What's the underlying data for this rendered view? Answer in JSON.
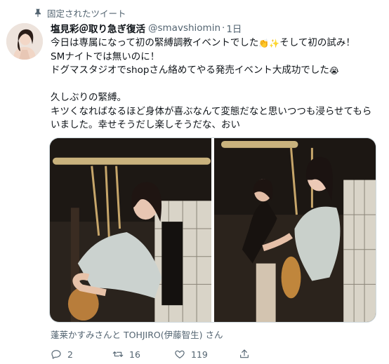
{
  "pinned": {
    "label": "固定されたツイート",
    "icon": "pin-icon"
  },
  "author": {
    "display_name": "塩見彩＠取り急ぎ復活",
    "handle": "@smavshiomin",
    "separator": "·",
    "time": "1日"
  },
  "tweet": {
    "line1_before_emoji": "今日は専属になって初の緊縛調教イベントでした",
    "line1_emoji1": "👏",
    "line1_emoji2": "✨",
    "line1_after_emoji": "そして初の試み！",
    "line2": "SMナイトでは無いのに！",
    "line3_text": "ドグマスタジオでshopさん絡めてやる発売イベント大成功でした",
    "line3_emoji": "😭",
    "line4": "久しぶりの緊縛。",
    "line5": "キツくなればなるほど身体が喜ぶなんて変態だなと思いつつも浸らせてもら",
    "line6": "いました。幸せそうだし楽しそうだな、おい"
  },
  "media": [
    {
      "name": "tweet-photo-1"
    },
    {
      "name": "tweet-photo-2"
    }
  ],
  "tagged": {
    "text": "蓬莱かすみさんと TOHJIRO(伊藤智生) さん",
    "icon": "person-tag-icon"
  },
  "actions": {
    "reply_count": "2",
    "retweet_count": "16",
    "like_count": "119",
    "share_icon": "share-icon"
  },
  "colors": {
    "text": "#0f1419",
    "secondary": "#536471",
    "border": "#cfd9de"
  }
}
